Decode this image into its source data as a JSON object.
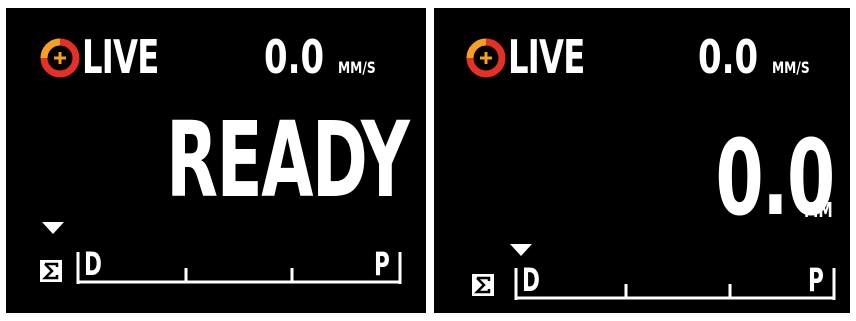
{
  "screens": [
    {
      "live_label": "LIVE",
      "speed_value": "0.0",
      "speed_unit": "MM/S",
      "state_text": "READY",
      "scale_start_label": "D",
      "scale_end_label": "P",
      "icons": [
        "live-target-icon",
        "sigma-icon",
        "position-marker-icon"
      ]
    },
    {
      "live_label": "LIVE",
      "speed_value": "0.0",
      "speed_unit": "MM/S",
      "position_value": "0.0",
      "position_unit": "MM",
      "scale_start_label": "D",
      "scale_end_label": "P",
      "icons": [
        "live-target-icon",
        "sigma-icon",
        "position-marker-icon"
      ]
    }
  ],
  "colors": {
    "background": "#000000",
    "text": "#ffffff",
    "ring_red": "#e53027",
    "ring_orange": "#f4a024",
    "plus": "#f4a024"
  }
}
